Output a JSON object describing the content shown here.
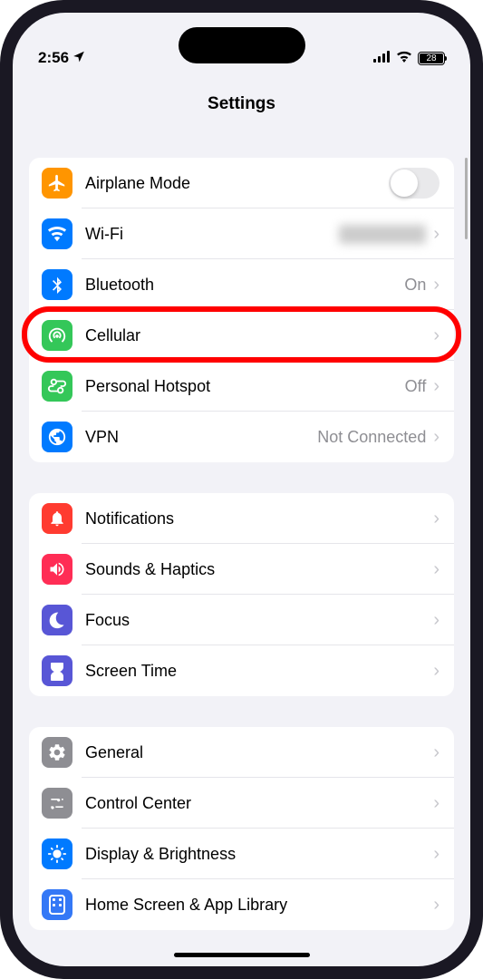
{
  "status": {
    "time": "2:56",
    "battery_level": "28"
  },
  "header": {
    "title": "Settings"
  },
  "groups": [
    {
      "rows": [
        {
          "id": "airplane",
          "icon_bg": "#ff9500",
          "label": "Airplane Mode",
          "type": "toggle",
          "toggle_on": false
        },
        {
          "id": "wifi",
          "icon_bg": "#007aff",
          "label": "Wi-Fi",
          "value_blurred": true,
          "type": "disclosure"
        },
        {
          "id": "bluetooth",
          "icon_bg": "#007aff",
          "label": "Bluetooth",
          "value": "On",
          "type": "disclosure"
        },
        {
          "id": "cellular",
          "icon_bg": "#34c759",
          "label": "Cellular",
          "type": "disclosure",
          "highlighted": true
        },
        {
          "id": "hotspot",
          "icon_bg": "#34c759",
          "label": "Personal Hotspot",
          "value": "Off",
          "type": "disclosure"
        },
        {
          "id": "vpn",
          "icon_bg": "#007aff",
          "label": "VPN",
          "value": "Not Connected",
          "type": "disclosure"
        }
      ]
    },
    {
      "rows": [
        {
          "id": "notifications",
          "icon_bg": "#ff3b30",
          "label": "Notifications",
          "type": "disclosure"
        },
        {
          "id": "sounds",
          "icon_bg": "#ff2d55",
          "label": "Sounds & Haptics",
          "type": "disclosure"
        },
        {
          "id": "focus",
          "icon_bg": "#5856d6",
          "label": "Focus",
          "type": "disclosure"
        },
        {
          "id": "screentime",
          "icon_bg": "#5856d6",
          "label": "Screen Time",
          "type": "disclosure"
        }
      ]
    },
    {
      "rows": [
        {
          "id": "general",
          "icon_bg": "#8e8e93",
          "label": "General",
          "type": "disclosure"
        },
        {
          "id": "controlcenter",
          "icon_bg": "#8e8e93",
          "label": "Control Center",
          "type": "disclosure"
        },
        {
          "id": "display",
          "icon_bg": "#007aff",
          "label": "Display & Brightness",
          "type": "disclosure"
        },
        {
          "id": "homescreen",
          "icon_bg": "#3478f6",
          "label": "Home Screen & App Library",
          "type": "disclosure"
        }
      ]
    }
  ]
}
